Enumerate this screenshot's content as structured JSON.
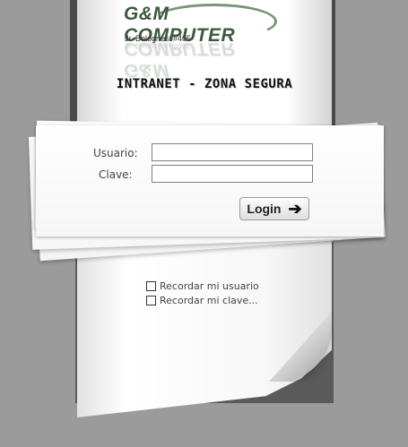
{
  "logo": {
    "brand": "G&M COMPUTER",
    "address": "Jr. Bolognesi #405"
  },
  "page": {
    "title": "INTRANET - ZONA SEGURA"
  },
  "form": {
    "user_label": "Usuario:",
    "user_value": "",
    "password_label": "Clave:",
    "password_value": "",
    "login_label": "Login",
    "login_icon": "arrow-right-icon"
  },
  "options": {
    "remember_user": "Recordar mi usuario",
    "remember_password": "Recordar mi clave..."
  }
}
